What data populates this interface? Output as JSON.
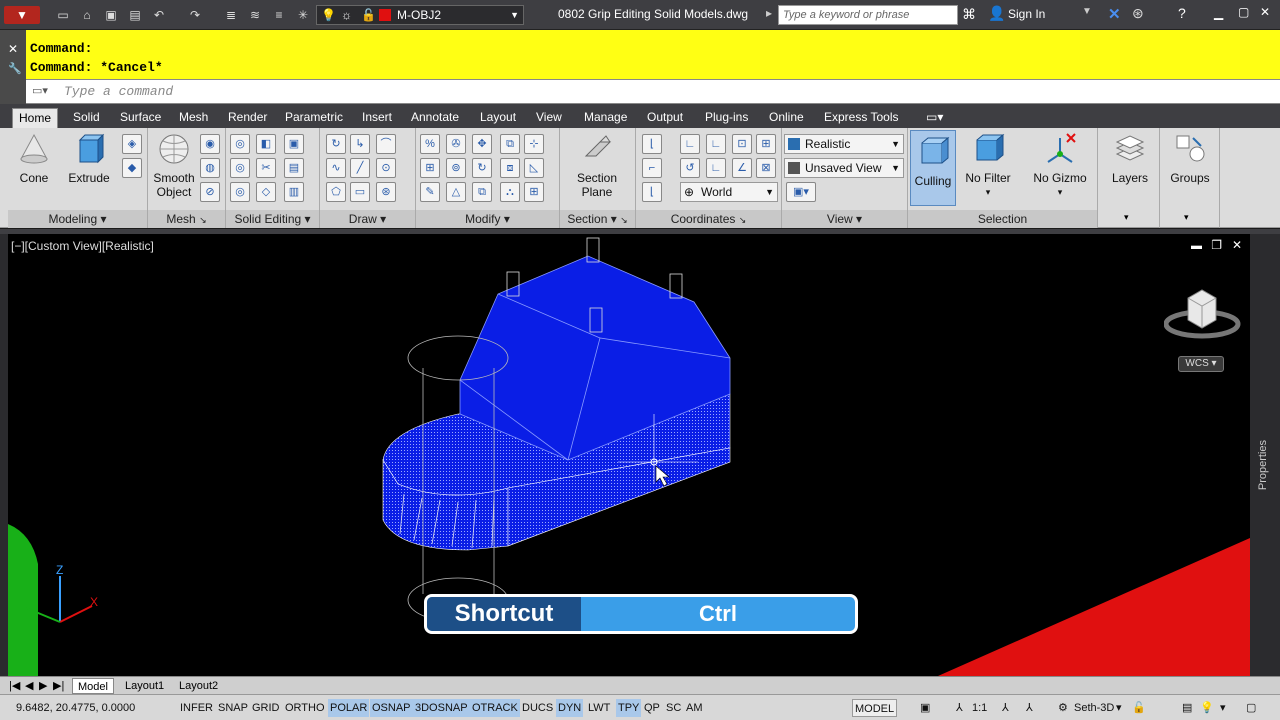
{
  "titlebar": {
    "layer_name": "M-OBJ2",
    "document_title": "0802 Grip Editing Solid Models.dwg",
    "search_placeholder": "Type a keyword or phrase",
    "sign_in": "Sign In"
  },
  "command": {
    "history": [
      "Command:",
      "Command: *Cancel*"
    ],
    "placeholder": "Type a command"
  },
  "ribbon_tabs": [
    "Home",
    "Solid",
    "Surface",
    "Mesh",
    "Render",
    "Parametric",
    "Insert",
    "Annotate",
    "Layout",
    "View",
    "Manage",
    "Output",
    "Plug-ins",
    "Online",
    "Express Tools"
  ],
  "active_tab": "Home",
  "panels": {
    "modeling": {
      "title": "Modeling",
      "cone": "Cone",
      "extrude": "Extrude"
    },
    "mesh": {
      "title": "Mesh",
      "smooth_object": "Smooth Object"
    },
    "solid_editing": {
      "title": "Solid Editing"
    },
    "draw": {
      "title": "Draw"
    },
    "modify": {
      "title": "Modify"
    },
    "section": {
      "title": "Section",
      "section_plane": "Section Plane"
    },
    "coordinates": {
      "title": "Coordinates",
      "world": "World"
    },
    "view": {
      "title": "View",
      "visual_style": "Realistic",
      "named_view": "Unsaved View"
    },
    "selection": {
      "title": "Selection",
      "culling": "Culling",
      "no_filter": "No Filter",
      "no_gizmo": "No Gizmo"
    },
    "layers": {
      "label": "Layers"
    },
    "groups": {
      "label": "Groups"
    }
  },
  "viewport": {
    "label": "[−][Custom View][Realistic]",
    "wcs": "WCS"
  },
  "shortcut": {
    "label": "Shortcut",
    "key": "Ctrl"
  },
  "layout_tabs": [
    "Model",
    "Layout1",
    "Layout2"
  ],
  "status": {
    "coords": "9.6482, 20.4775, 0.0000",
    "toggles": [
      "INFER",
      "SNAP",
      "GRID",
      "ORTHO",
      "POLAR",
      "OSNAP",
      "3DOSNAP",
      "OTRACK",
      "DUCS",
      "DYN",
      "LWT",
      "TPY",
      "QP",
      "SC",
      "AM"
    ],
    "model": "MODEL",
    "scale": "1:1",
    "workspace": "Seth-3D"
  },
  "properties_label": "Properties",
  "colors": {
    "accent": "#3a9ee8",
    "cmd_history_bg": "#ffff14",
    "solid_blue": "#0a1ee6",
    "red_plane": "#e01010",
    "green_obj": "#18b018"
  }
}
